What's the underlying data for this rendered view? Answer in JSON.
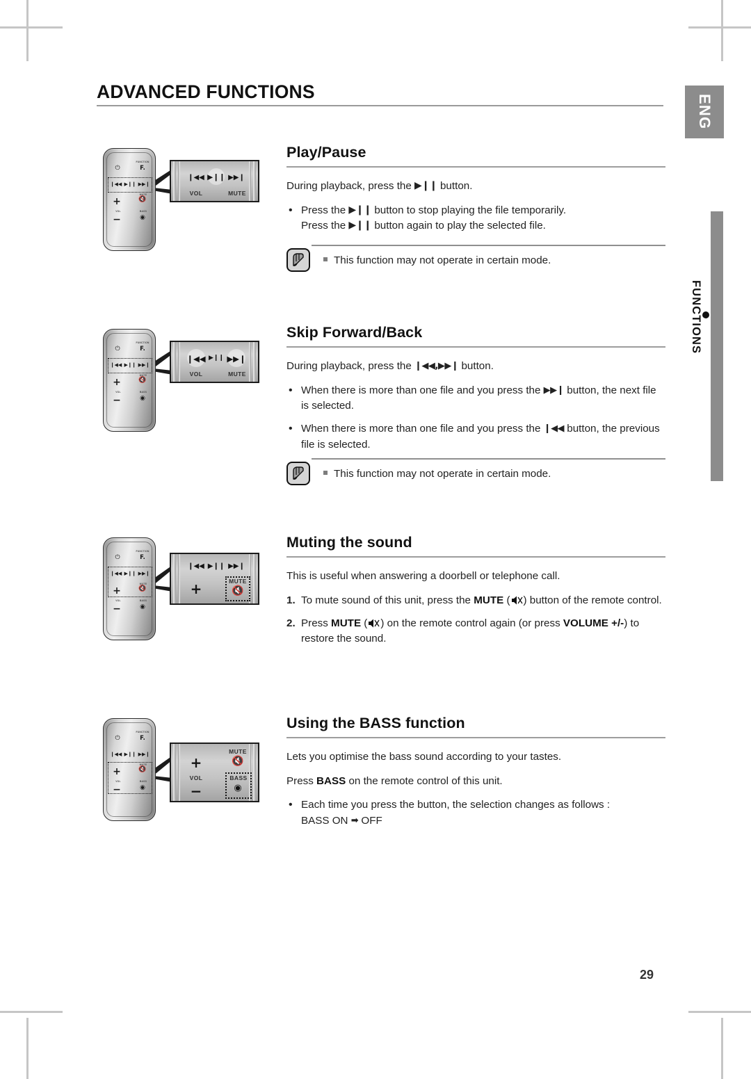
{
  "page": {
    "title": "ADVANCED FUNCTIONS",
    "number": "29",
    "lang_tab": "ENG",
    "side_tab": "FUNCTIONS"
  },
  "sections": [
    {
      "id": "play-pause",
      "heading": "Play/Pause",
      "intro_before": "During playback, press the ",
      "intro_glyph": "▶❙❙",
      "intro_after": " button.",
      "bullets": [
        {
          "line1_before": "Press the ",
          "glyph": "▶❙❙",
          "line1_after": " button to stop playing the file temporarily.",
          "line2_before": "Press the ",
          "line2_after": " button again to play the selected file."
        }
      ],
      "note": "This function may not operate in certain mode."
    },
    {
      "id": "skip-forward-back",
      "heading": "Skip Forward/Back",
      "intro_before": "During playback, press the ",
      "intro_glyph": "❙◀◀,▶▶❙",
      "intro_after": " button.",
      "bullets": [
        {
          "before": "When there is more than one file and you press the ",
          "glyph": "▶▶❙",
          "after": " button, the next file is selected."
        },
        {
          "before": "When there is more than one file and you press the ",
          "glyph": "❙◀◀",
          "after": " button, the previous file is selected."
        }
      ],
      "note": "This function may not operate in certain mode."
    },
    {
      "id": "muting-the-sound",
      "heading": "Muting the sound",
      "intro": "This is useful when answering a doorbell or telephone call.",
      "steps": [
        {
          "num": "1.",
          "p1": "To mute sound of this unit, press the ",
          "strong1": "MUTE",
          "p2": " (",
          "icon": "mute-icon",
          "p3": ") button of the remote control."
        },
        {
          "num": "2.",
          "p1": "Press ",
          "strong1": "MUTE",
          "p2": " (",
          "icon": "mute-icon",
          "p3": ") on the remote control again (or press ",
          "strong2": "VOLUME +/-",
          "p4": ") to restore the sound."
        }
      ]
    },
    {
      "id": "using-the-bass-function",
      "heading": "Using the BASS function",
      "intro": "Lets you optimise the bass sound according to your tastes.",
      "press_before": "Press ",
      "press_strong": "BASS",
      "press_after": " on the remote control of this unit.",
      "bullet_line1": "Each time you press the button, the selection changes as follows :",
      "bullet_line2_a": "BASS ON",
      "bullet_arrow": "➡",
      "bullet_line2_b": "OFF"
    }
  ],
  "remote": {
    "keys": {
      "power": "⏻",
      "function_label": "FUNCTION",
      "function_key": "F.",
      "prev": "❙◀◀",
      "playpause": "▶❙❙",
      "next": "▶▶❙",
      "vol_up": "+",
      "vol_down": "−",
      "vol_label": "VOL",
      "mute_label": "MUTE",
      "bass_label": "BASS"
    }
  },
  "callouts": [
    {
      "id": "callout-playpause",
      "highlight": "playpause",
      "left_label": "VOL",
      "right_label": "MUTE"
    },
    {
      "id": "callout-skip",
      "highlight": "skip",
      "left_label": "VOL",
      "right_label": "MUTE"
    },
    {
      "id": "callout-mute",
      "highlight": "mute",
      "mute_label": "MUTE"
    },
    {
      "id": "callout-bass",
      "highlight": "bass",
      "mute_label": "MUTE",
      "vol_label": "VOL",
      "bass_label": "BASS"
    }
  ],
  "colors": {
    "tab_gray": "#8c8c8c",
    "rule_gray": "#9a9a9a",
    "text": "#222222"
  }
}
